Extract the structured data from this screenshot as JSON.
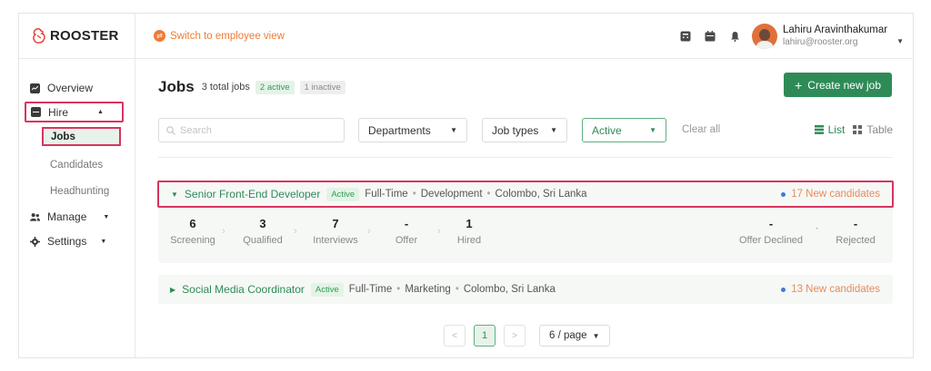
{
  "brand": {
    "name": "ROOSTER"
  },
  "topbar": {
    "switch_label": "Switch to employee view",
    "user_name": "Lahiru Aravinthakumar",
    "user_email": "lahiru@rooster.org"
  },
  "sidebar": {
    "overview": "Overview",
    "hire": "Hire",
    "jobs": "Jobs",
    "candidates": "Candidates",
    "headhunting": "Headhunting",
    "manage": "Manage",
    "settings": "Settings"
  },
  "header": {
    "title": "Jobs",
    "total": "3 total jobs",
    "active_badge": "2 active",
    "inactive_badge": "1 inactive",
    "create_button": "Create new job"
  },
  "filters": {
    "search_placeholder": "Search",
    "departments": "Departments",
    "job_types": "Job types",
    "status": "Active",
    "clear_all": "Clear all",
    "view_list": "List",
    "view_table": "Table"
  },
  "jobs": [
    {
      "title": "Senior Front-End Developer",
      "status": "Active",
      "type": "Full-Time",
      "department": "Development",
      "location": "Colombo, Sri Lanka",
      "new_candidates": "17 New candidates",
      "stages": [
        {
          "count": "6",
          "label": "Screening"
        },
        {
          "count": "3",
          "label": "Qualified"
        },
        {
          "count": "7",
          "label": "Interviews"
        },
        {
          "count": "-",
          "label": "Offer"
        },
        {
          "count": "1",
          "label": "Hired"
        },
        {
          "count": "-",
          "label": "Offer Declined"
        },
        {
          "count": "-",
          "label": "Rejected"
        }
      ]
    },
    {
      "title": "Social Media Coordinator",
      "status": "Active",
      "type": "Full-Time",
      "department": "Marketing",
      "location": "Colombo, Sri Lanka",
      "new_candidates": "13 New candidates"
    }
  ],
  "pagination": {
    "prev": "<",
    "current_page": "1",
    "next": ">",
    "per_page": "6 / page"
  },
  "colors": {
    "primary": "#2e8b57",
    "accent_orange": "#f07b33",
    "highlight_border": "#d8345f",
    "new_candidate_text": "#e88a5a"
  }
}
